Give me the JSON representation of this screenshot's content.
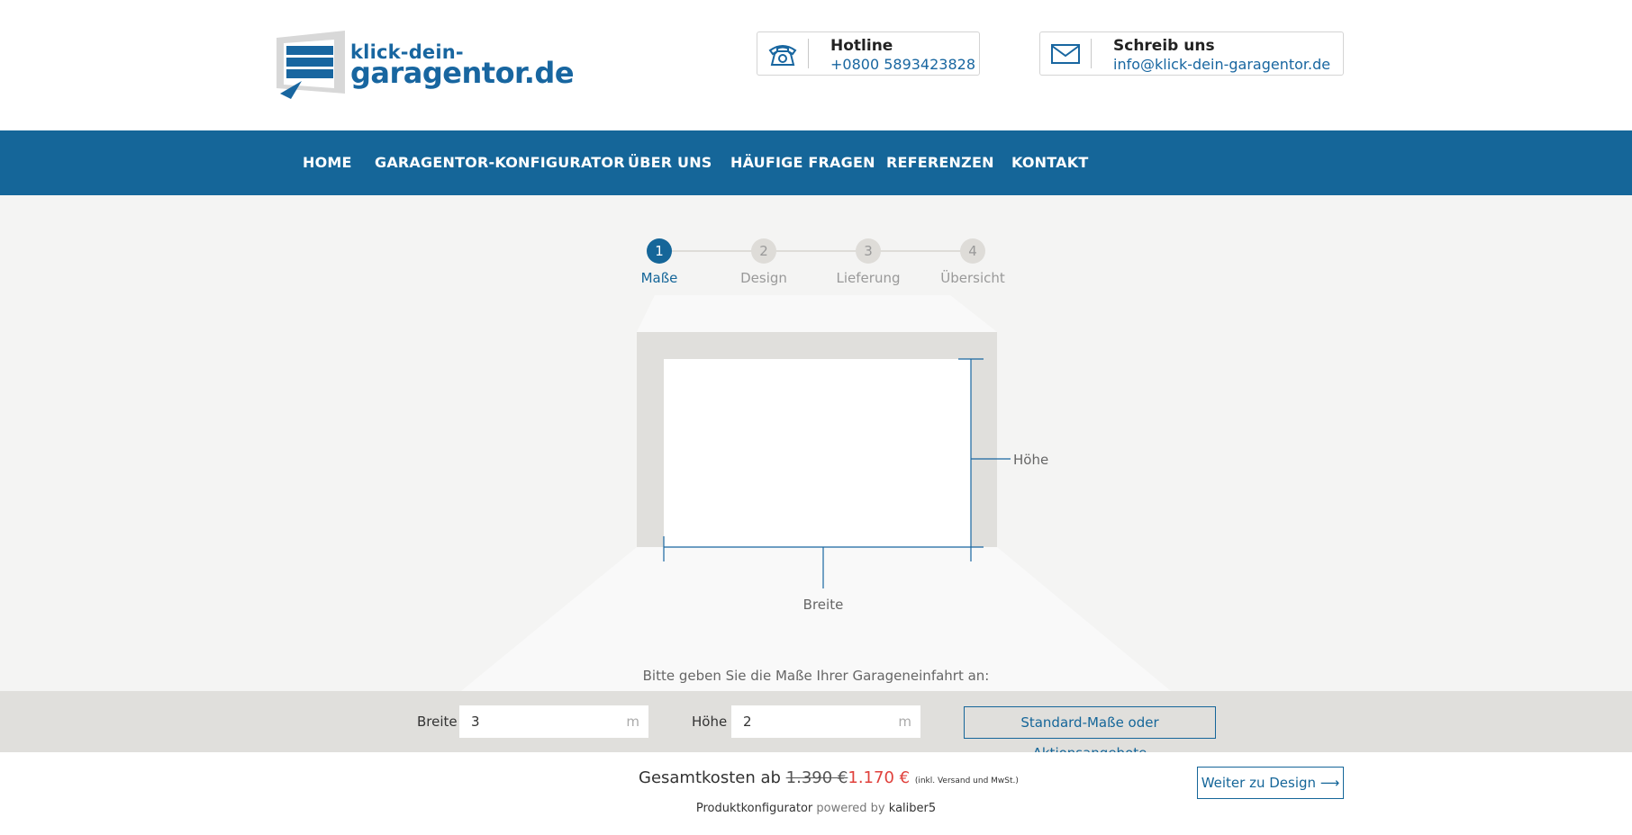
{
  "brand": {
    "logo_line1": "klick-dein-",
    "logo_line2": "garagentor.de",
    "color": "#1866a0"
  },
  "contacts": {
    "hotline": {
      "title": "Hotline",
      "value": "+0800 5893423828",
      "icon": "phone-icon"
    },
    "mail": {
      "title": "Schreib uns",
      "value": "info@klick-dein-garagentor.de",
      "icon": "envelope-icon"
    }
  },
  "nav": {
    "items": [
      {
        "label": "HOME"
      },
      {
        "label": "GARAGENTOR-KONFIGURATOR"
      },
      {
        "label": "ÜBER UNS"
      },
      {
        "label": "HÄUFIGE FRAGEN"
      },
      {
        "label": "REFERENZEN"
      },
      {
        "label": "KONTAKT"
      }
    ],
    "background": "#156699"
  },
  "stepper": {
    "steps": [
      {
        "number": "1",
        "label": "Maße"
      },
      {
        "number": "2",
        "label": "Design"
      },
      {
        "number": "3",
        "label": "Lieferung"
      },
      {
        "number": "4",
        "label": "Übersicht"
      }
    ],
    "active_step": 1
  },
  "diagram": {
    "height_label": "Höhe",
    "width_label": "Breite"
  },
  "hint": "Bitte geben Sie die Maße Ihrer Garageneinfahrt an:",
  "inputs": {
    "width": {
      "label": "Breite",
      "value": "3",
      "unit": "m"
    },
    "height": {
      "label": "Höhe",
      "value": "2",
      "unit": "m"
    },
    "standard_button": "Standard-Maße oder Aktionsangebote"
  },
  "footer": {
    "total_prefix": "Gesamtkosten ab",
    "old_price": "1.390 €",
    "new_price": "1.170 €",
    "price_note": "(inkl. Versand und MwSt.)",
    "powered_product": "Produktkonfigurator",
    "powered_by": "powered by",
    "powered_company": "kaliber5",
    "next_button": "Weiter zu Design ⟶",
    "price_color": "#e0413c"
  }
}
